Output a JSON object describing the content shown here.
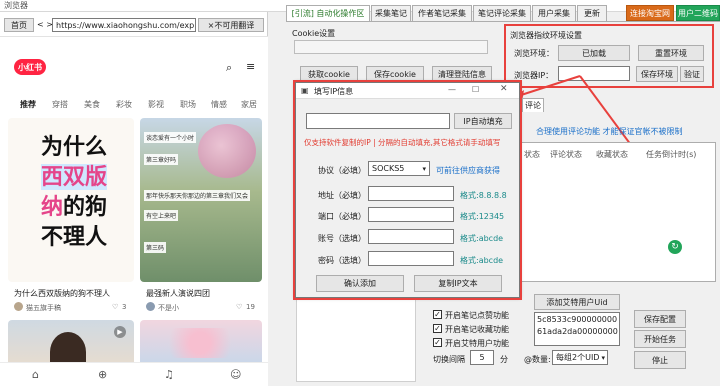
{
  "window": {
    "title": "浏览器"
  },
  "browser": {
    "home_btn": "首页",
    "nav_arrows": "< >",
    "url": "https://www.xiaohongshu.com/explor",
    "close_btn": "×不可用翻译",
    "logo": "小红书",
    "categories": [
      "推荐",
      "穿搭",
      "美食",
      "彩妆",
      "影视",
      "职场",
      "情感",
      "家居"
    ],
    "cards": [
      {
        "image_text": "为什么西双版纳的狗不理人",
        "title": "为什么西双版纳的狗不理人",
        "author": "猫五旗手稿",
        "likes": "3"
      },
      {
        "overlay_lines": [
          "谈恋爱有一个小时",
          "第三章好吗",
          "那年快乐那天你那边的第三章我们又会",
          "有空上来吧",
          "第三码"
        ],
        "title": "最强新人演说四团",
        "author": "不是小",
        "likes": "19"
      },
      {
        "title": "",
        "author": "",
        "likes": ""
      },
      {
        "title": "",
        "author": "",
        "likes": ""
      }
    ]
  },
  "tabs": [
    "[引流] 自动化操作区",
    "采集笔记",
    "作者笔记采集",
    "笔记评论采集",
    "用户采集",
    "更新"
  ],
  "badges": {
    "contact": "连接淘宝网",
    "qr": "用户二维码"
  },
  "cookie": {
    "group_label": "Cookie设置",
    "get_btn": "获取cookie",
    "save_btn": "保存cookie",
    "clear_btn": "清理登陆信息"
  },
  "env": {
    "group_label": "浏览器指纹环境设置",
    "env_label": "浏览环境：",
    "loaded_btn": "已加载",
    "reset_btn": "重置环境",
    "ip_label": "浏览器IP：",
    "save_env_btn": "保存环境",
    "verify_btn": "验证"
  },
  "main": {
    "chat_tab": "评论",
    "hint": "合理使用评论功能 才能保证官帐不被限制",
    "columns": [
      "状态",
      "评论状态",
      "收藏状态",
      "任务倒计时(s)"
    ],
    "add_user_btn": "添加艾特用户Uid",
    "uid_list": [
      "5c8533c900000000",
      "61ada2da00000000"
    ],
    "checks": [
      "开启笔记点赞功能",
      "开启笔记收藏功能",
      "开启艾特用户功能"
    ],
    "interval_label": "切换间隔",
    "interval_value": "5",
    "interval_unit": "分",
    "at_count_label": "@数量:",
    "at_count_value": "每组2个UID",
    "save_config_btn": "保存配置",
    "start_btn": "开始任务",
    "stop_btn": "停止"
  },
  "dialog": {
    "title": "填写IP信息",
    "auto_fill_btn": "IP自动填充",
    "warning": "仅支持软件复制的IP | 分隔的自动填充,其它格式请手动填写",
    "protocol_label": "协议（必填）",
    "protocol_value": "SOCKS5",
    "supplier_link": "可前往供应商获得",
    "host_label": "地址（必填）",
    "host_hint": "格式:8.8.8.8",
    "port_label": "端口（必填）",
    "port_hint": "格式:12345",
    "user_label": "账号（选填）",
    "user_hint": "格式:abcde",
    "pass_label": "密码（选填）",
    "pass_hint": "格式:abcde",
    "confirm_btn": "确认添加",
    "copy_btn": "复制IP文本"
  }
}
